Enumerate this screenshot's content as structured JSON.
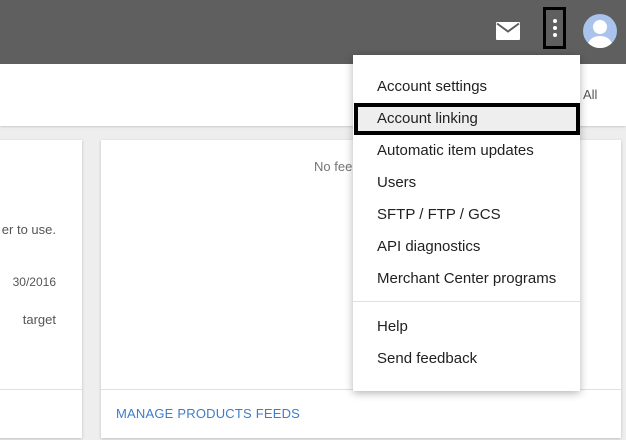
{
  "topbar": {
    "mail_icon": "mail-icon",
    "more_icon": "more-vert-icon",
    "avatar_icon": "person-icon"
  },
  "subheader": {
    "all_label": "All"
  },
  "left_card": {
    "lines": [
      "er to use.",
      "30/2016",
      "target"
    ]
  },
  "right_card": {
    "empty_text": "No fee",
    "link_label": "MANAGE PRODUCTS FEEDS"
  },
  "menu": {
    "items": [
      {
        "label": "Account settings"
      },
      {
        "label": "Account linking"
      },
      {
        "label": "Automatic item updates"
      },
      {
        "label": "Users"
      },
      {
        "label": "SFTP / FTP / GCS"
      },
      {
        "label": "API diagnostics"
      },
      {
        "label": "Merchant Center programs"
      },
      {
        "label": "Help"
      },
      {
        "label": "Send feedback"
      }
    ]
  },
  "colors": {
    "topbar": "#5f5f5f",
    "link": "#3f7dc8",
    "highlight_border": "#000000",
    "avatar": "#a9c3ec"
  }
}
